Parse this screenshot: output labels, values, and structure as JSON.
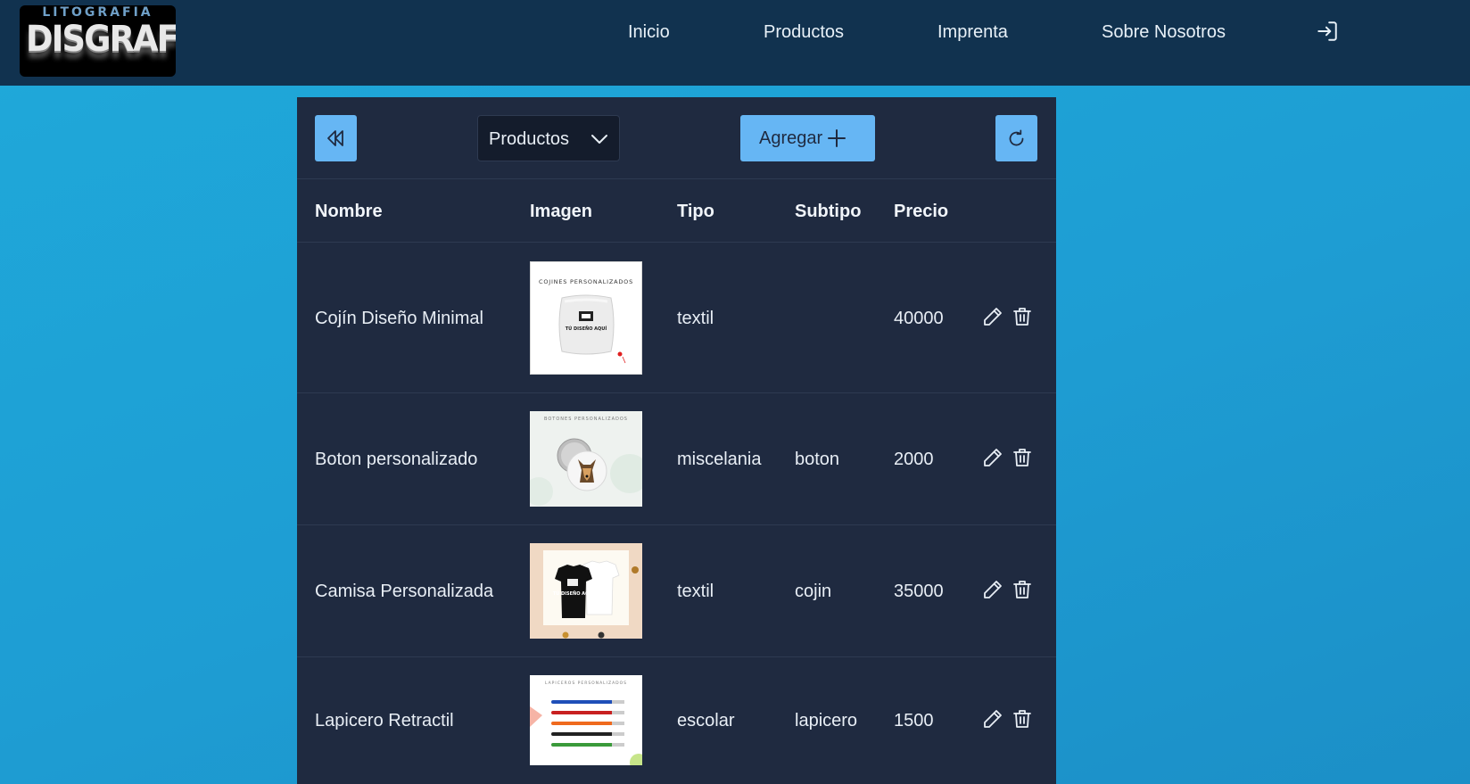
{
  "header": {
    "logo_top": "LITOGRAFIA",
    "logo_main": "DISGRAFIC",
    "nav": {
      "inicio": "Inicio",
      "productos": "Productos",
      "imprenta": "Imprenta",
      "sobre": "Sobre Nosotros"
    },
    "login_icon": "sign-in-icon"
  },
  "toolbar": {
    "back_icon": "double-chevron-left-icon",
    "select_value": "Productos",
    "select_icon": "chevron-down-icon",
    "add_label": "Agregar",
    "add_icon": "plus-icon",
    "refresh_icon": "refresh-icon"
  },
  "table": {
    "headers": {
      "nombre": "Nombre",
      "imagen": "Imagen",
      "tipo": "Tipo",
      "subtipo": "Subtipo",
      "precio": "Precio"
    },
    "rows": [
      {
        "nombre": "Cojín Diseño Minimal",
        "tipo": "textil",
        "subtipo": "",
        "precio": "40000",
        "thumb_caption": "COJINES PERSONALIZADOS",
        "thumb_text": "TÚ DISEÑO AQUÍ"
      },
      {
        "nombre": "Boton personalizado",
        "tipo": "miscelania",
        "subtipo": "boton",
        "precio": "2000",
        "thumb_caption": "BOTONES PERSONALIZADOS"
      },
      {
        "nombre": "Camisa Personalizada",
        "tipo": "textil",
        "subtipo": "cojin",
        "precio": "35000",
        "thumb_text": "TÚ DISEÑO AQUÍ"
      },
      {
        "nombre": "Lapicero Retractil",
        "tipo": "escolar",
        "subtipo": "lapicero",
        "precio": "1500",
        "thumb_caption": "LAPICEROS PERSONALIZADOS"
      }
    ],
    "edit_icon": "pencil-icon",
    "delete_icon": "trash-icon"
  },
  "colors": {
    "navbar": "#11324f",
    "background": "#1fa9da",
    "panel": "#1f2a40",
    "accent": "#66b6f4"
  }
}
